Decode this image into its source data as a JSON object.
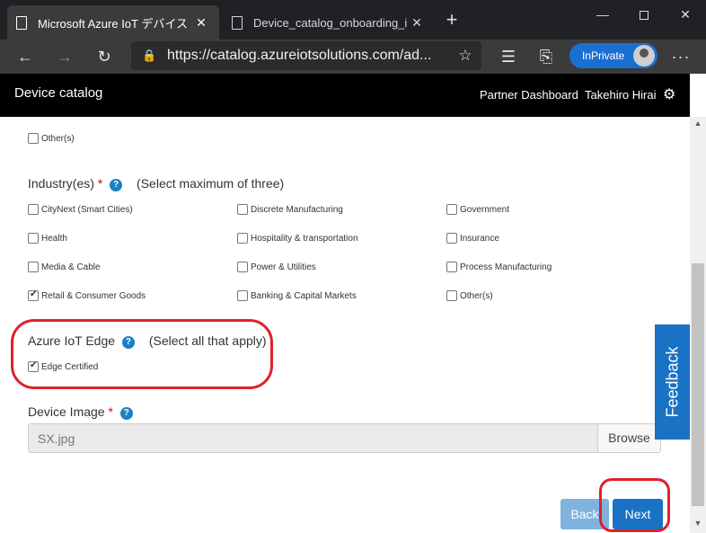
{
  "browser": {
    "tabs": [
      {
        "title": "Microsoft Azure IoT デバイス カタD",
        "close": "✕"
      },
      {
        "title": "Device_catalog_onboarding_instr",
        "close": "✕"
      }
    ],
    "new_tab": "+",
    "url": "https://catalog.azureiotsolutions.com/ad...",
    "inprivate_label": "InPrivate"
  },
  "header": {
    "brand": "Device catalog",
    "partner_dashboard": "Partner Dashboard",
    "user_name": "Takehiro Hirai"
  },
  "form": {
    "other_top": {
      "label": "Other(s)",
      "checked": false
    },
    "industry": {
      "label": "Industry(es)",
      "required_mark": "*",
      "hint": "(Select maximum of three)",
      "options": [
        {
          "label": "CityNext (Smart Cities)",
          "checked": false
        },
        {
          "label": "Discrete Manufacturing",
          "checked": false
        },
        {
          "label": "Government",
          "checked": false
        },
        {
          "label": "Health",
          "checked": false
        },
        {
          "label": "Hospitality & transportation",
          "checked": false
        },
        {
          "label": "Insurance",
          "checked": false
        },
        {
          "label": "Media & Cable",
          "checked": false
        },
        {
          "label": "Power & Utilities",
          "checked": false
        },
        {
          "label": "Process Manufacturing",
          "checked": false
        },
        {
          "label": "Retail & Consumer Goods",
          "checked": true
        },
        {
          "label": "Banking & Capital Markets",
          "checked": false
        },
        {
          "label": "Other(s)",
          "checked": false
        }
      ]
    },
    "iot_edge": {
      "label": "Azure IoT Edge",
      "hint": "(Select all that apply)",
      "options": [
        {
          "label": "Edge Certified",
          "checked": true
        }
      ]
    },
    "device_image": {
      "label": "Device Image",
      "required_mark": "*",
      "file_name": "SX.jpg",
      "browse_label": "Browse"
    },
    "back_label": "Back",
    "next_label": "Next"
  },
  "feedback_label": "Feedback",
  "colors": {
    "primary": "#1a72c4",
    "primary_disabled": "#7fb3de",
    "annotation": "#e0202a",
    "required": "#e00000",
    "header_bg": "#000000"
  }
}
